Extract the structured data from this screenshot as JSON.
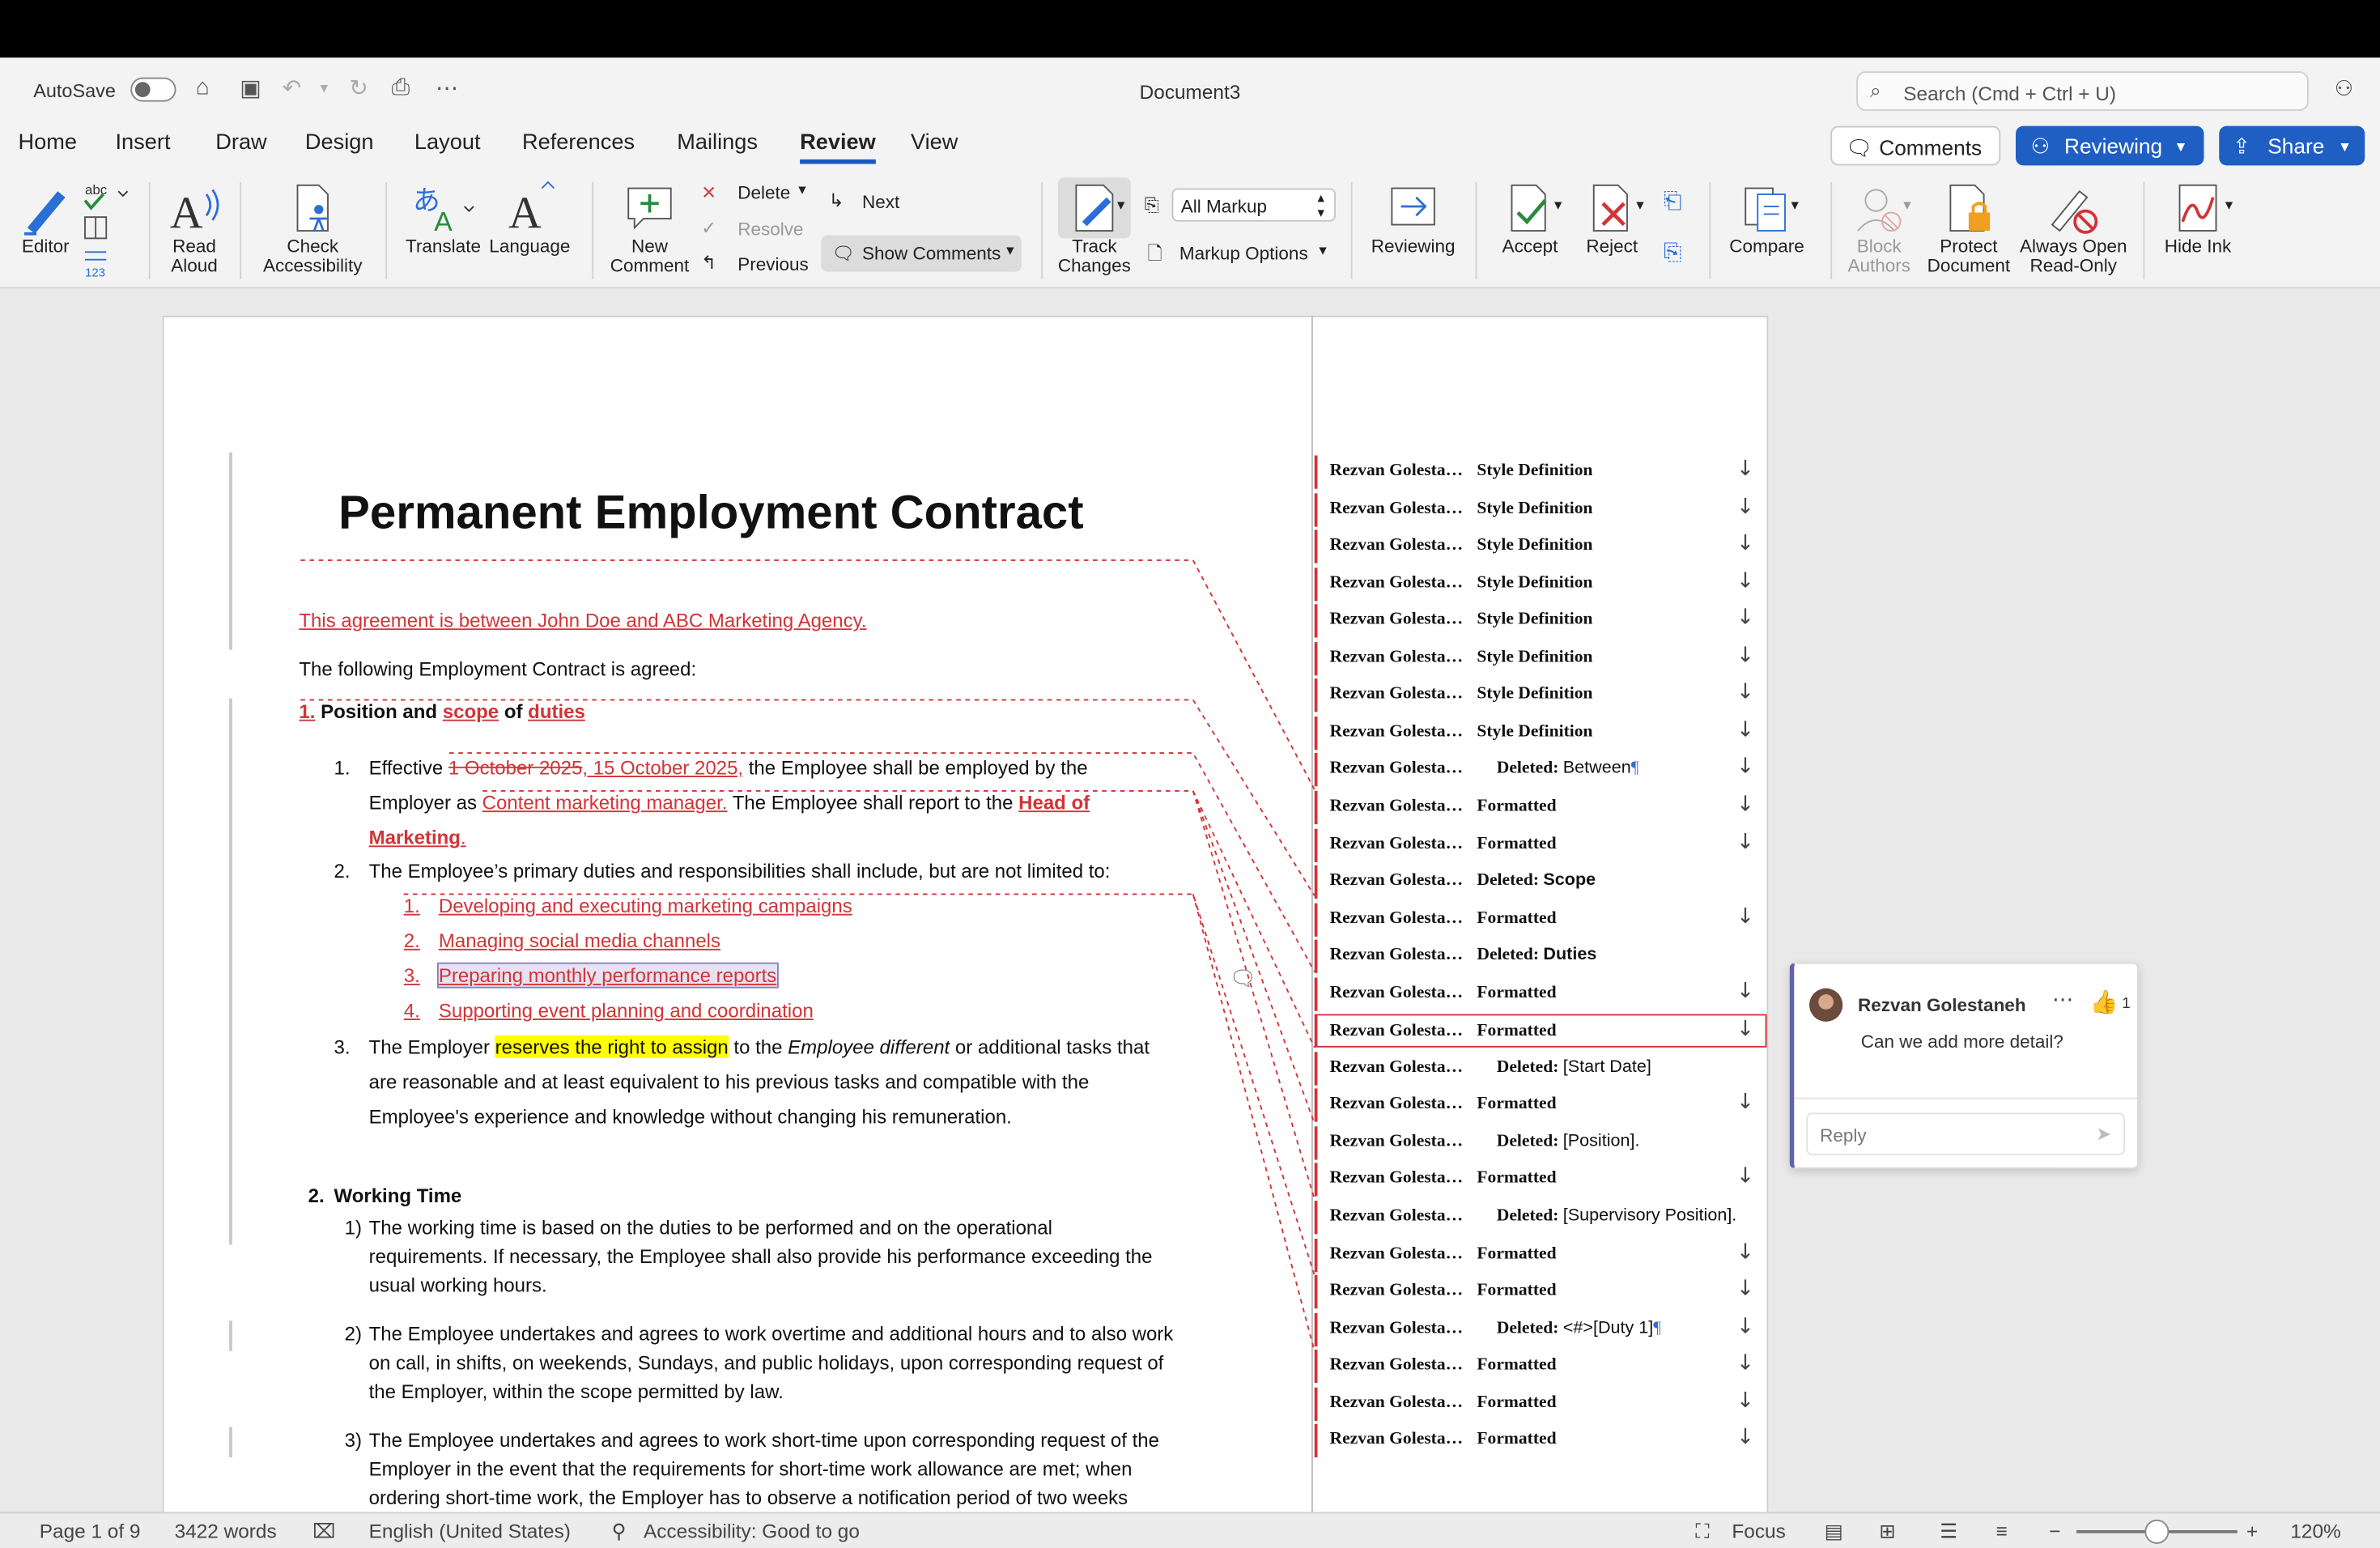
{
  "titlebar": {
    "autosave_label": "AutoSave",
    "document_title": "Document3",
    "search_placeholder": "Search (Cmd + Ctrl + U)"
  },
  "tabs": [
    "Home",
    "Insert",
    "Draw",
    "Design",
    "Layout",
    "References",
    "Mailings",
    "Review",
    "View"
  ],
  "active_tab": "Review",
  "header_buttons": {
    "comments": "Comments",
    "reviewing": "Reviewing",
    "share": "Share"
  },
  "ribbon": {
    "editor": "Editor",
    "read_aloud": [
      "Read",
      "Aloud"
    ],
    "check_accessibility": [
      "Check",
      "Accessibility"
    ],
    "translate": "Translate",
    "language": "Language",
    "new_comment": [
      "New",
      "Comment"
    ],
    "delete": "Delete",
    "resolve": "Resolve",
    "previous": "Previous",
    "next": "Next",
    "show_comments": "Show Comments",
    "track_changes": [
      "Track",
      "Changes"
    ],
    "all_markup": "All Markup",
    "markup_options": "Markup Options",
    "reviewing": "Reviewing",
    "accept": "Accept",
    "reject": "Reject",
    "compare": "Compare",
    "block_authors": [
      "Block",
      "Authors"
    ],
    "protect_document": [
      "Protect",
      "Document"
    ],
    "always_open_read_only": [
      "Always Open",
      "Read-Only"
    ],
    "hide_ink": "Hide Ink"
  },
  "document": {
    "title": "Permanent Employment Contract",
    "intro_inserted": "This agreement is between John Doe and ABC Marketing Agency.",
    "intro": "The following Employment Contract is agreed:",
    "s1_num": "1.",
    "s1_a": "Position and",
    "s1_scope": "scope",
    "s1_of": "of",
    "s1_duties": "duties",
    "p1_num": "1.",
    "p1_a": "Effective",
    "p1_deleted_date": "1 October 2025",
    "p1_inserted_date": ", 15 October 2025,",
    "p1_b": "the Employee shall be employed by the",
    "p1_c": "Employer as",
    "p1_inserted_role": "Content marketing manager.",
    "p1_d": "The Employee shall report to the",
    "p1_inserted_head": "Head of",
    "p1_inserted_marketing": "Marketing",
    "p1_inserted_dot": ".",
    "p2_num": "2.",
    "p2": "The Employee’s primary duties and responsibilities shall include, but are not limited to:",
    "duties": [
      {
        "num": "1.",
        "text": "Developing and executing marketing campaigns"
      },
      {
        "num": "2.",
        "text": "Managing social media channels"
      },
      {
        "num": "3.",
        "text": "Preparing monthly performance reports"
      },
      {
        "num": "4.",
        "text": "Supporting event planning and coordination"
      }
    ],
    "p3_num": "3.",
    "p3_a": "The Employer",
    "p3_hl": "reserves the right to assign",
    "p3_b": "to the",
    "p3_it": "Employee different",
    "p3_c": "or additional tasks that",
    "p3_line2": "are reasonable and at least equivalent to his previous tasks and compatible with the",
    "p3_line3": "Employee's experience and knowledge without changing his remuneration.",
    "s2_num": "2.",
    "s2_title": "Working Time",
    "w1_num": "1)",
    "w1": [
      "The working time is based on the duties to be performed and on the operational",
      "requirements. If necessary, the Employee shall also provide his performance exceeding the",
      "usual working hours."
    ],
    "w2_num": "2)",
    "w2": [
      "The Employee undertakes and agrees to work overtime and additional hours and to also work",
      "on call, in shifts, on weekends, Sundays, and public holidays, upon corresponding request of",
      "the Employer, within the scope permitted by law."
    ],
    "w3_num": "3)",
    "w3": [
      "The Employee undertakes and agrees to work short-time upon corresponding request of the",
      "Employer in the event that the requirements for short-time work allowance are met; when",
      "ordering short-time work, the Employer has to observe a notification period of two weeks"
    ]
  },
  "markup_balloons": [
    {
      "author": "Rezvan Golesta…",
      "label": "Style Definition",
      "detail": "",
      "arrow": true
    },
    {
      "author": "Rezvan Golesta…",
      "label": "Style Definition",
      "detail": "",
      "arrow": true
    },
    {
      "author": "Rezvan Golesta…",
      "label": "Style Definition",
      "detail": "",
      "arrow": true
    },
    {
      "author": "Rezvan Golesta…",
      "label": "Style Definition",
      "detail": "",
      "arrow": true
    },
    {
      "author": "Rezvan Golesta…",
      "label": "Style Definition",
      "detail": "",
      "arrow": true
    },
    {
      "author": "Rezvan Golesta…",
      "label": "Style Definition",
      "detail": "",
      "arrow": true
    },
    {
      "author": "Rezvan Golesta…",
      "label": "Style Definition",
      "detail": "",
      "arrow": true
    },
    {
      "author": "Rezvan Golesta…",
      "label": "Style Definition",
      "detail": "",
      "arrow": true
    },
    {
      "author": "Rezvan Golesta…",
      "label": "Deleted:",
      "detail": "Between",
      "pilcrow": "¶",
      "arrow": true
    },
    {
      "author": "Rezvan Golesta…",
      "label": "Formatted",
      "detail": "",
      "arrow": true
    },
    {
      "author": "Rezvan Golesta…",
      "label": "Formatted",
      "detail": "",
      "arrow": true
    },
    {
      "author": "Rezvan Golesta…",
      "label": "Deleted:",
      "detail": "Scope",
      "bold_detail": true,
      "arrow": false
    },
    {
      "author": "Rezvan Golesta…",
      "label": "Formatted",
      "detail": "",
      "arrow": true
    },
    {
      "author": "Rezvan Golesta…",
      "label": "Deleted:",
      "detail": "Duties",
      "bold_detail": true,
      "arrow": false
    },
    {
      "author": "Rezvan Golesta…",
      "label": "Formatted",
      "detail": "",
      "arrow": true
    },
    {
      "author": "Rezvan Golesta…",
      "label": "Formatted",
      "detail": "",
      "arrow": true,
      "boxed": true
    },
    {
      "author": "Rezvan Golesta…",
      "label": "Deleted:",
      "detail": "[Start Date]",
      "arrow": false
    },
    {
      "author": "Rezvan Golesta…",
      "label": "Formatted",
      "detail": "",
      "arrow": true
    },
    {
      "author": "Rezvan Golesta…",
      "label": "Deleted:",
      "detail": "[Position].",
      "arrow": false
    },
    {
      "author": "Rezvan Golesta…",
      "label": "Formatted",
      "detail": "",
      "arrow": true
    },
    {
      "author": "Rezvan Golesta…",
      "label": "Deleted:",
      "detail": "[Supervisory Position].",
      "arrow": false
    },
    {
      "author": "Rezvan Golesta…",
      "label": "Formatted",
      "detail": "",
      "arrow": true
    },
    {
      "author": "Rezvan Golesta…",
      "label": "Formatted",
      "detail": "",
      "arrow": true
    },
    {
      "author": "Rezvan Golesta…",
      "label": "Deleted:",
      "detail": "<#>[Duty 1]",
      "pilcrow": "¶",
      "arrow": true
    },
    {
      "author": "Rezvan Golesta…",
      "label": "Formatted",
      "detail": "",
      "arrow": true
    },
    {
      "author": "Rezvan Golesta…",
      "label": "Formatted",
      "detail": "",
      "arrow": true
    },
    {
      "author": "Rezvan Golesta…",
      "label": "Formatted",
      "detail": "",
      "arrow": true
    }
  ],
  "comment": {
    "author": "Rezvan Golestaneh",
    "text": "Can we add more detail?",
    "likes": "1",
    "reply_placeholder": "Reply"
  },
  "status": {
    "page": "Page 1 of 9",
    "words": "3422 words",
    "language": "English (United States)",
    "accessibility": "Accessibility: Good to go",
    "focus": "Focus",
    "zoom": "120%",
    "zoom_level": 0.5
  },
  "colors": {
    "accent": "#185abd",
    "revision": "#d13438",
    "highlight": "#ffff00"
  }
}
